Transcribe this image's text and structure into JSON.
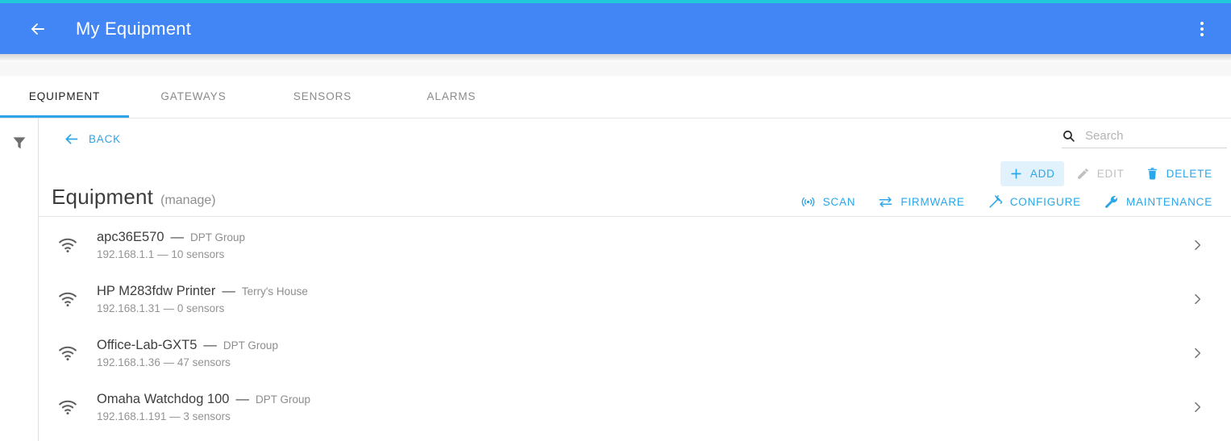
{
  "theme": {
    "accent_strip": "#20c7d9",
    "appbar_blue": "#4285f4",
    "link_blue": "#2ba6e8",
    "add_highlight_bg": "#e2f2fd",
    "disabled_gray": "#c0c0c0"
  },
  "appbar": {
    "back_icon": "arrow-left-icon",
    "title": "My Equipment",
    "menu_icon": "kebab-menu-icon"
  },
  "tabs": [
    {
      "label": "EQUIPMENT",
      "active": true
    },
    {
      "label": "GATEWAYS",
      "active": false
    },
    {
      "label": "SENSORS",
      "active": false
    },
    {
      "label": "ALARMS",
      "active": false
    }
  ],
  "filter_rail": {
    "icon": "filter-funnel-icon"
  },
  "toolbar": {
    "back_label": "BACK",
    "back_icon": "arrow-left-icon"
  },
  "search": {
    "icon": "search-icon",
    "placeholder": "Search",
    "value": ""
  },
  "primary_actions": [
    {
      "label": "ADD",
      "icon": "plus-icon",
      "state": "highlight"
    },
    {
      "label": "EDIT",
      "icon": "pencil-icon",
      "state": "disabled"
    },
    {
      "label": "DELETE",
      "icon": "trash-icon",
      "state": "enabled"
    }
  ],
  "secondary_actions": [
    {
      "label": "SCAN",
      "icon": "broadcast-icon"
    },
    {
      "label": "FIRMWARE",
      "icon": "swap-arrows-icon"
    },
    {
      "label": "CONFIGURE",
      "icon": "magic-wand-icon"
    },
    {
      "label": "MAINTENANCE",
      "icon": "wrench-icon"
    }
  ],
  "page": {
    "title": "Equipment",
    "subtitle": "(manage)"
  },
  "equipment_list": [
    {
      "icon": "wifi-icon",
      "name": "apc36E570",
      "separator": "—",
      "group": "DPT Group",
      "detail": "192.168.1.1 — 10 sensors",
      "chevron": "chevron-right-icon"
    },
    {
      "icon": "wifi-icon",
      "name": "HP M283fdw Printer",
      "separator": "—",
      "group": "Terry's House",
      "detail": "192.168.1.31 — 0 sensors",
      "chevron": "chevron-right-icon"
    },
    {
      "icon": "wifi-icon",
      "name": "Office-Lab-GXT5",
      "separator": "—",
      "group": "DPT Group",
      "detail": "192.168.1.36 — 47 sensors",
      "chevron": "chevron-right-icon"
    },
    {
      "icon": "wifi-icon",
      "name": "Omaha Watchdog 100",
      "separator": "—",
      "group": "DPT Group",
      "detail": "192.168.1.191 — 3 sensors",
      "chevron": "chevron-right-icon"
    }
  ]
}
